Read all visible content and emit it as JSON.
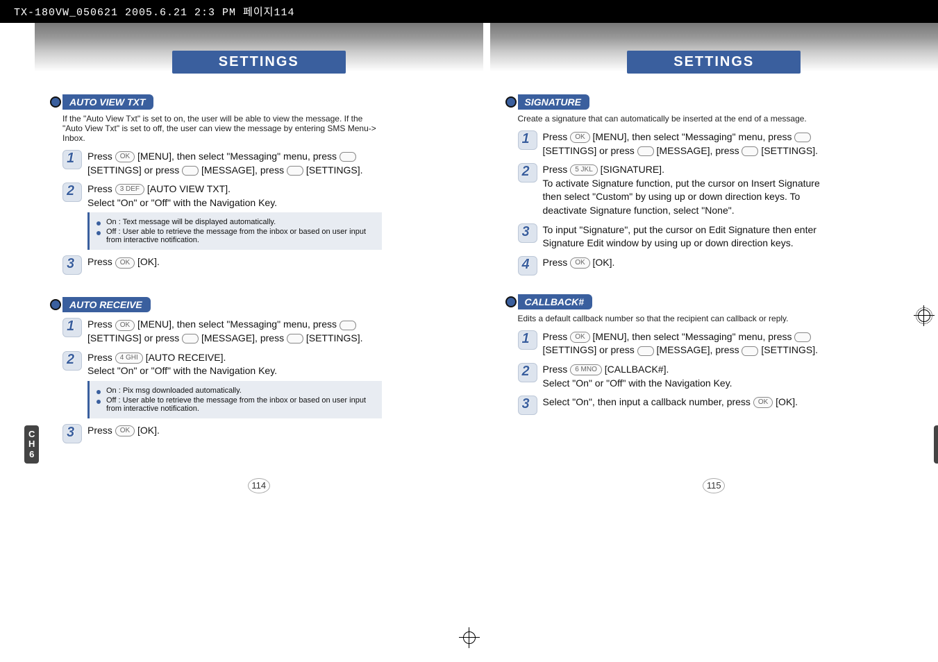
{
  "file_header": "TX-180VW_050621  2005.6.21 2:3 PM  페이지114",
  "chapter_label_c": "C",
  "chapter_label_h": "H",
  "chapter_label_num": "6",
  "left": {
    "title": "SETTINGS",
    "page_num": "114",
    "section1": {
      "label": "AUTO VIEW TXT",
      "intro": "If the \"Auto View Txt\" is set to on, the user will be able to view the message. If the \"Auto View Txt\" is set to off, the user can view the message by entering SMS Menu-> Inbox.",
      "step1": "Press      [MENU], then select \"Messaging\" menu, press      [SETTINGS] or press      [MESSAGE], press      [SETTINGS].",
      "step2a": "Press      [AUTO VIEW TXT].",
      "step2b": "Select \"On\" or \"Off\" with the Navigation Key.",
      "note_on": "On : Text message will be displayed automatically.",
      "note_off": "Off : User able to retrieve the message from the inbox or based on user input from interactive notification.",
      "step3": "Press      [OK]."
    },
    "section2": {
      "label": "AUTO RECEIVE",
      "step1": "Press      [MENU], then select \"Messaging\" menu, press      [SETTINGS] or press      [MESSAGE], press      [SETTINGS].",
      "step2a": "Press      [AUTO RECEIVE].",
      "step2b": "Select \"On\" or \"Off\" with the Navigation Key.",
      "note_on": "On : Pix msg downloaded automatically.",
      "note_off": "Off : User able to retrieve the message from the inbox or based on user input from interactive notification.",
      "step3": "Press      [OK]."
    }
  },
  "right": {
    "title": "SETTINGS",
    "page_num": "115",
    "section1": {
      "label": "SIGNATURE",
      "intro": "Create a signature that can automatically be inserted at the end of a message.",
      "step1": "Press      [MENU], then select \"Messaging\" menu, press      [SETTINGS] or press      [MESSAGE], press      [SETTINGS].",
      "step2a": "Press      [SIGNATURE].",
      "step2b": "To activate Signature function, put the cursor on Insert Signature then select \"Custom\" by using up or down direction keys. To deactivate Signature function, select \"None\".",
      "step3": "To input \"Signature\", put the cursor on Edit Signature then enter Signature Edit window by using up or down direction keys.",
      "step4": "Press      [OK]."
    },
    "section2": {
      "label": "CALLBACK#",
      "intro": "Edits a default callback number so that the recipient can callback or reply.",
      "step1": "Press      [MENU], then select \"Messaging\" menu, press      [SETTINGS] or press      [MESSAGE], press      [SETTINGS].",
      "step2a": "Press      [CALLBACK#].",
      "step2b": "Select \"On\" or \"Off\" with the Navigation Key.",
      "step3": "Select \"On\", then input a callback number, press      [OK]."
    }
  },
  "keys": {
    "ok": "OK",
    "three": "3 DEF",
    "four": "4 GHI",
    "five": "5 JKL",
    "six": "6 MNO"
  }
}
